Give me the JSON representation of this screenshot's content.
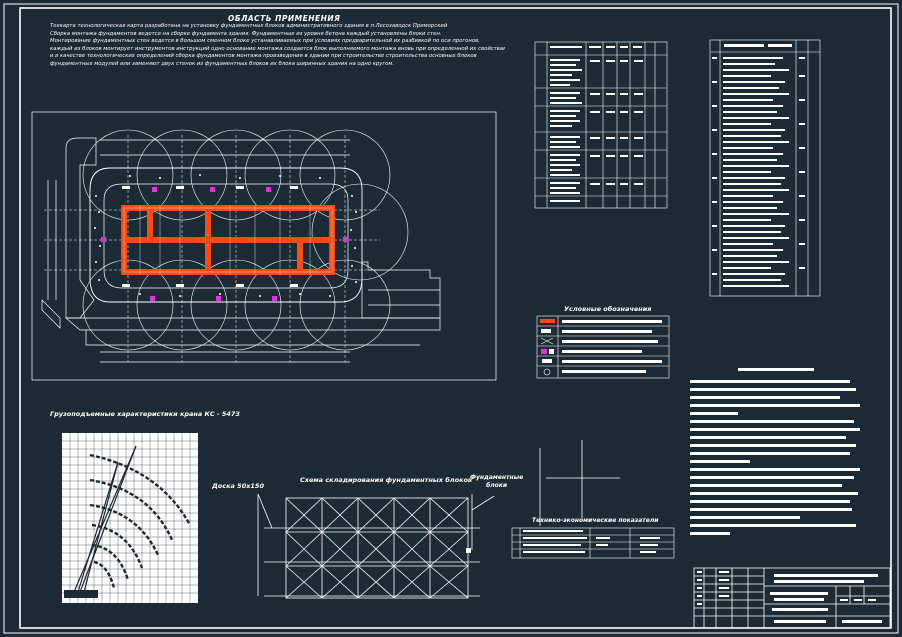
{
  "sheet": {
    "heading": "ОБЛАСТЬ ПРИМЕНЕНИЯ",
    "scope_lines": [
      "Техкарта технологическая карта разработана на установку фундаментных блоков административного здания в п.Лесозаводск Приморский",
      "Сборка монтажа фундаментов ведется на сборке фундамента здания. Фундаментные из уровня бетона каждый установлены блоки стен.",
      "Монтирование фундаментных стен ведется в большом сменном блоке устанавливаемых при условиях предварительной их разбивкой по оси прогонов,",
      "каждый из блоков монтирует инструментов инструкций одно основание монтажа создается блок выполняемого монтажа вновь при определенной их свойствам способом",
      "и в качестве технологических определений сборка фундаментов монтажа произведения в здании при строительстве строительства основных блоков",
      "фундаментных модулей или заменяют двух стенок из фундаментных блоков их блока ширинных здания на одно кругом."
    ],
    "crane_title": "Грузоподъемные характеристики крана КС - 5473",
    "plank_label": "Доска 50х150",
    "stack_title": "Схема складирования фундаментных блоков",
    "block_label": "Фундаментные\nблоки",
    "legend_title": "Условные обозначения",
    "tech_table_title": "Технико-экономические показатели"
  },
  "colors": {
    "background": "#1c2a36",
    "line": "#ffffff",
    "foundation": "#ff4a12",
    "marker": "#e030e0"
  }
}
